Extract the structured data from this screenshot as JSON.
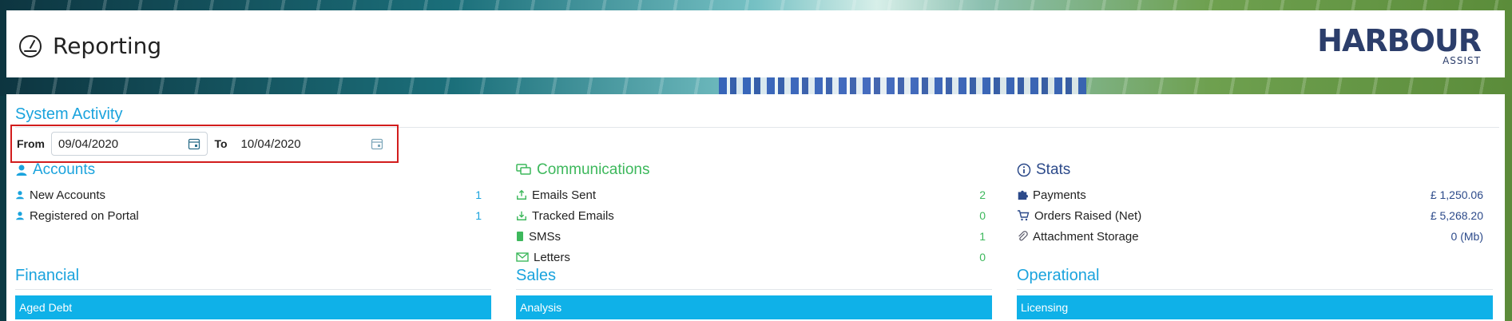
{
  "header": {
    "title": "Reporting",
    "logo_word": "HARBOUR",
    "logo_sub": "ASSIST"
  },
  "system_activity": {
    "title": "System Activity",
    "from_label": "From",
    "from_value": "09/04/2020",
    "to_label": "To",
    "to_value": "10/04/2020"
  },
  "accounts": {
    "title": "Accounts",
    "rows": [
      {
        "label": "New Accounts",
        "value": "1"
      },
      {
        "label": "Registered on Portal",
        "value": "1"
      }
    ]
  },
  "communications": {
    "title": "Communications",
    "rows": [
      {
        "label": "Emails Sent",
        "value": "2"
      },
      {
        "label": "Tracked Emails",
        "value": "0"
      },
      {
        "label": "SMSs",
        "value": "1"
      },
      {
        "label": "Letters",
        "value": "0"
      }
    ]
  },
  "stats": {
    "title": "Stats",
    "rows": [
      {
        "label": "Payments",
        "value": "£ 1,250.06"
      },
      {
        "label": "Orders Raised (Net)",
        "value": "£ 5,268.20"
      },
      {
        "label": "Attachment Storage",
        "value": "0 (Mb)"
      }
    ]
  },
  "financial": {
    "title": "Financial",
    "bar": "Aged Debt"
  },
  "sales": {
    "title": "Sales",
    "bar": "Analysis"
  },
  "operational": {
    "title": "Operational",
    "bar": "Licensing"
  },
  "colors": {
    "accent_blue": "#1aa3dd",
    "green": "#3db85c",
    "navy": "#2c4a8a",
    "highlight_red": "#d21d1d"
  }
}
